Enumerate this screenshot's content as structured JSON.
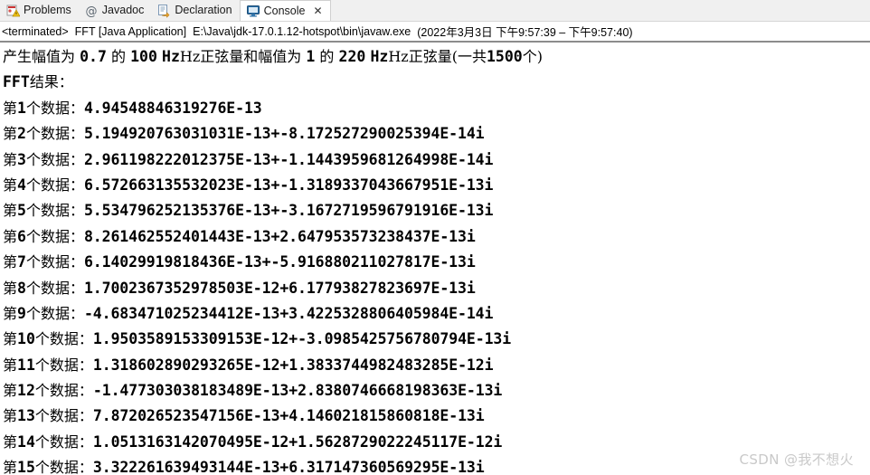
{
  "tabs": [
    {
      "id": "problems",
      "label": "Problems",
      "icon": "problems-icon",
      "active": false,
      "closable": false
    },
    {
      "id": "javadoc",
      "label": "Javadoc",
      "icon": "javadoc-at-icon",
      "active": false,
      "closable": false
    },
    {
      "id": "declaration",
      "label": "Declaration",
      "icon": "declaration-icon",
      "active": false,
      "closable": false
    },
    {
      "id": "console",
      "label": "Console",
      "icon": "console-icon",
      "active": true,
      "closable": true
    }
  ],
  "tab_close_glyph": "✕",
  "title": {
    "status": "<terminated>",
    "launch": "FFT [Java Application]",
    "path": "E:\\Java\\jdk-17.0.1.12-hotspot\\bin\\javaw.exe",
    "timestamp": "(2022年3月3日 下午9:57:39 – 下午9:57:40)"
  },
  "console": {
    "header_line": {
      "seg1": "产生幅值为",
      "amp1": "0.7",
      "seg2": "的",
      "freq1": "100",
      "seg3": "Hz正弦量和幅值为",
      "amp2": "1",
      "seg4": "的",
      "freq2": "220",
      "seg5": "Hz正弦量(一共",
      "count": "1500",
      "seg6": "个)"
    },
    "result_label": "FFT结果：",
    "row_prefix": "第",
    "row_suffix": "个数据：",
    "rows": [
      {
        "index": "1",
        "value": "4.94548846319276E-13"
      },
      {
        "index": "2",
        "value": "5.1949207630310 31E-13+-8.172527290025394E-14i"
      },
      {
        "index": "3",
        "value": "2.9611982220 12375E-13+-1.1443959681264998E-14i"
      },
      {
        "index": "4",
        "value": "6.5726631355 32023E-13+-1.3189337043667951E-13i"
      },
      {
        "index": "5",
        "value": "5.5347962521 35376E-13+-3.1672719596791916E-13i"
      },
      {
        "index": "6",
        "value": "8.2614625524 01443E-13+2.647953573238437E-13i"
      },
      {
        "index": "7",
        "value": "6.14029919818436E-13+-5.916880211027817E-13i"
      },
      {
        "index": "8",
        "value": "1.7002367352978503E-12+6.17793827823697E-13i"
      },
      {
        "index": "9",
        "value": "-4.683471025234412E-13+3.4225328806405984E-14i"
      },
      {
        "index": "10",
        "value": "1.9503589153309153E-12+-3.0985425756780794E-13i"
      },
      {
        "index": "11",
        "value": "1.318602890293265E-12+1.3833744982483285E-12i"
      },
      {
        "index": "12",
        "value": "-1.477303038183489E-13+2.8380746668198363E-13i"
      },
      {
        "index": "13",
        "value": "7.872026523547156E-13+4.146021815860818E-13i"
      },
      {
        "index": "14",
        "value": "1.0513163142070495E-12+1.5628729022245117E-12i"
      },
      {
        "index": "15",
        "value": "3.322261639493144E-13+6.3171473605 69295E-13i"
      }
    ]
  },
  "watermark": "CSDN @我不想火",
  "colors": {
    "tabbar_bg": "#f0f0f0",
    "console_bg": "#ffffff",
    "divider": "#8c8c8c",
    "text": "#000000",
    "watermark": "#c9c9c9"
  }
}
